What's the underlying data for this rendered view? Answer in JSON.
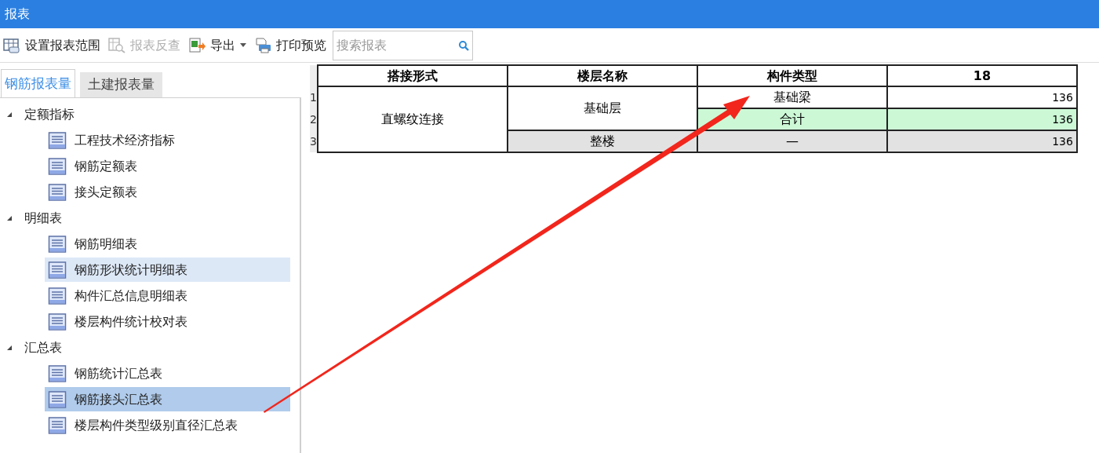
{
  "window": {
    "title": "报表"
  },
  "toolbar": [
    {
      "label": "设置报表范围",
      "kind": "range",
      "disabled": false
    },
    {
      "label": "报表反查",
      "kind": "lookup",
      "disabled": true
    },
    {
      "label": "导出",
      "kind": "export",
      "disabled": false,
      "dropdown": true
    },
    {
      "label": "打印预览",
      "kind": "print",
      "disabled": false
    }
  ],
  "search": {
    "placeholder": "搜索报表"
  },
  "tabs": [
    {
      "label": "钢筋报表量",
      "selected": true
    },
    {
      "label": "土建报表量",
      "selected": false
    }
  ],
  "tree": [
    {
      "label": "定额指标",
      "expanded": true,
      "children": [
        {
          "label": "工程技术经济指标",
          "selected": false,
          "hovered": false
        },
        {
          "label": "钢筋定额表",
          "selected": false,
          "hovered": false
        },
        {
          "label": "接头定额表",
          "selected": false,
          "hovered": false
        }
      ]
    },
    {
      "label": "明细表",
      "expanded": true,
      "children": [
        {
          "label": "钢筋明细表",
          "selected": false,
          "hovered": false
        },
        {
          "label": "钢筋形状统计明细表",
          "selected": false,
          "hovered": true
        },
        {
          "label": "构件汇总信息明细表",
          "selected": false,
          "hovered": false
        },
        {
          "label": "楼层构件统计校对表",
          "selected": false,
          "hovered": false
        }
      ]
    },
    {
      "label": "汇总表",
      "expanded": true,
      "children": [
        {
          "label": "钢筋统计汇总表",
          "selected": false,
          "hovered": false
        },
        {
          "label": "钢筋接头汇总表",
          "selected": true,
          "hovered": false
        },
        {
          "label": "楼层构件类型级别直径汇总表",
          "selected": false,
          "hovered": false
        }
      ]
    }
  ],
  "table": {
    "columns": [
      "搭接形式",
      "楼层名称",
      "构件类型",
      "18"
    ],
    "rows": [
      {
        "number": "1",
        "kind": "plain",
        "cells": [
          {
            "text": "直螺纹连接",
            "rowspan": 3
          },
          {
            "text": "基础层",
            "rowspan": 2
          },
          {
            "text": "基础梁"
          },
          {
            "text": "136"
          }
        ]
      },
      {
        "number": "2",
        "kind": "subtotal",
        "cells": [
          {
            "text": "合计"
          },
          {
            "text": "136"
          }
        ]
      },
      {
        "number": "3",
        "kind": "total",
        "cells": [
          {
            "text": "整楼"
          },
          {
            "text": "—"
          },
          {
            "text": "136"
          }
        ]
      }
    ]
  }
}
